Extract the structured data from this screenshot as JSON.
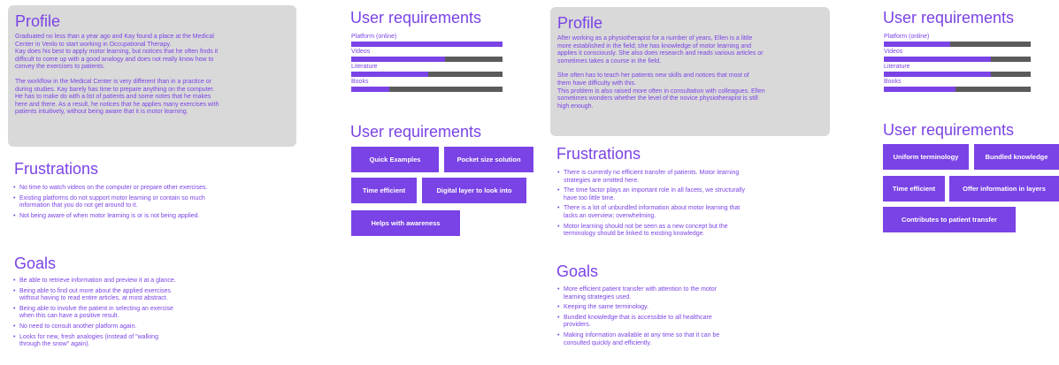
{
  "left": {
    "profile": {
      "title": "Profile",
      "paragraph1": "Graduated no less than a year ago and Kay found a place at the Medical\nCenter in Venlo to start working in Occupational Therapy.\nKay does his best to apply motor learning, but notices that he often finds it\ndifficult to come up with a good analogy and does not really know how to\nconvey the exercises to patients.",
      "paragraph2": "The workflow in the Medical Center is very different than in a practice or\nduring studies. Kay barely has time to prepare anything on the computer.\nHe has to make do with a list of patients and some notes that he makes\nhere and there. As a result, he notices that he applies many exercises with\npatients intuitively, without being aware that it is motor learning."
    },
    "frustrations": {
      "title": "Frustrations",
      "items": [
        "No time to watch videos on the computer or prepare other exercises.",
        "Existing platforms do not support motor learning or contain so much\ninformation that you do not get around to it.",
        "Not being aware of when motor learning is or is not being applied."
      ]
    },
    "goals": {
      "title": "Goals",
      "items": [
        "Be able to retrieve information and preview it at a glance.",
        "Being able to find out more about the applied exercises\nwithout having to read entire articles, at most abstract.",
        "Being able to involve the patient in selecting an exercise\nwhen this can have a positive result.",
        "No need to consult another platform again.",
        "Looks for new, fresh analogies (instead of \"walking\nthrough the snow\" again)."
      ]
    },
    "requirements_bars": {
      "title": "User requirements",
      "items": [
        {
          "label": "Platform (online)",
          "value": 1.0
        },
        {
          "label": "Videos",
          "value": 0.62
        },
        {
          "label": "Literature",
          "value": 0.51
        },
        {
          "label": "Books",
          "value": 0.25
        }
      ]
    },
    "requirements_tags": {
      "title": "User requirements",
      "tags": [
        "Quick Examples",
        "Pocket size solution",
        "Time efficient",
        "Digital layer to look into",
        "Helps with awareness"
      ]
    }
  },
  "right": {
    "profile": {
      "title": "Profile",
      "paragraph1": "After working as a physiotherapist for a number of years, Ellen is a little\nmore established in the field; she has knowledge of motor learning and\napplies it consciously. She also does research and reads various articles or\nsometimes takes a course in the field.",
      "paragraph2": "She often has to teach her patients new skills and notices that most of\nthem have difficulty with this.\nThis problem is also raised more often in consultation with colleagues. Ellen\nsometimes wonders whether the level of the novice physiotherapist is still\nhigh enough."
    },
    "frustrations": {
      "title": "Frustrations",
      "items": [
        "There is currently no efficient transfer of patients. Motor learning\nstrategies are omitted here.",
        "The time factor plays an important role in all facets, we structurally\nhave too little time.",
        "There is a lot of unbundled information about motor learning that\nlacks an overview; overwhelming.",
        "Motor learning should not be seen as a new concept but the\nterminology should be linked to existing knowledge."
      ]
    },
    "goals": {
      "title": "Goals",
      "items": [
        "More efficient patient transfer with attention to the motor\nlearning strategies used.",
        "Keeping the same terminology.",
        "Bundled knowledge that is accessible to all healthcare\nproviders.",
        "Making information available at any time so that it can be\nconsulted quickly and efficiently."
      ]
    },
    "requirements_bars": {
      "title": "User requirements",
      "items": [
        {
          "label": "Platform (online)",
          "value": 0.45
        },
        {
          "label": "Videos",
          "value": 0.73
        },
        {
          "label": "Literature",
          "value": 0.73
        },
        {
          "label": "Books",
          "value": 0.49
        }
      ]
    },
    "requirements_tags": {
      "title": "User requirements",
      "tags": [
        "Uniform terminology",
        "Bundled knowledge",
        "Time efficient",
        "Offer information in layers",
        "Contributes to patient transfer"
      ]
    }
  },
  "colors": {
    "accent": "#7a43e6",
    "card_background": "#d9d9d9",
    "bar_track": "#5b5b5b"
  }
}
